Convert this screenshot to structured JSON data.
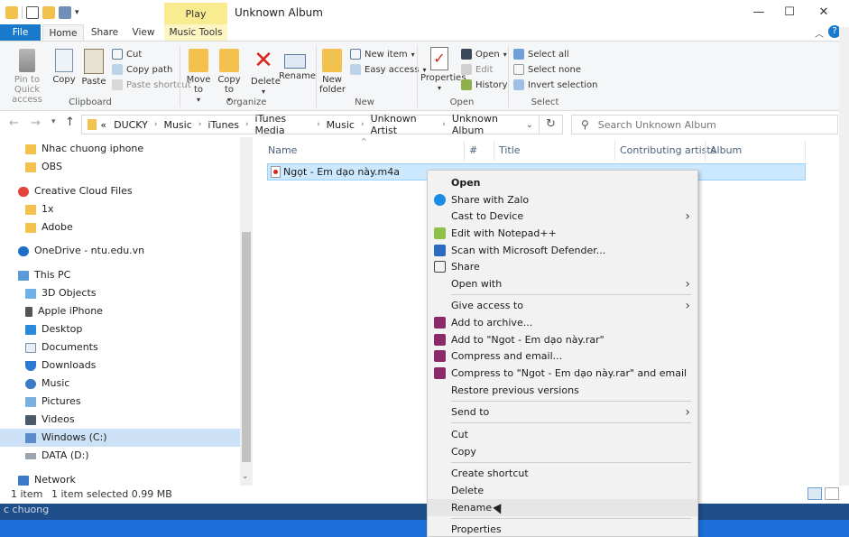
{
  "window": {
    "title": "Unknown Album",
    "play_tab": "Play",
    "controls": {
      "minimize": "—",
      "maximize": "☐",
      "close": "✕"
    }
  },
  "tabs": [
    {
      "label": "File"
    },
    {
      "label": "Home"
    },
    {
      "label": "Share"
    },
    {
      "label": "View"
    },
    {
      "label": "Music Tools"
    }
  ],
  "ribbon": {
    "clipboard": {
      "pin": "Pin to Quick access",
      "copy": "Copy",
      "paste": "Paste",
      "cut": "Cut",
      "copy_path": "Copy path",
      "paste_shortcut": "Paste shortcut",
      "label": "Clipboard"
    },
    "organize": {
      "move_to": "Move to",
      "copy_to": "Copy to",
      "delete": "Delete",
      "rename": "Rename",
      "label": "Organize"
    },
    "new": {
      "new_folder": "New folder",
      "new_item": "New item",
      "easy_access": "Easy access",
      "label": "New"
    },
    "open": {
      "properties": "Properties",
      "open": "Open",
      "edit": "Edit",
      "history": "History",
      "label": "Open"
    },
    "select": {
      "select_all": "Select all",
      "select_none": "Select none",
      "invert": "Invert selection",
      "label": "Select"
    }
  },
  "address": {
    "crumbs": [
      "«",
      "DUCKY",
      "Music",
      "iTunes",
      "iTunes Media",
      "Music",
      "Unknown Artist",
      "Unknown Album"
    ],
    "search_placeholder": "Search Unknown Album"
  },
  "nav": {
    "items": [
      {
        "label": "Nhac chuong iphone"
      },
      {
        "label": "OBS"
      },
      {
        "label": "Creative Cloud Files"
      },
      {
        "label": "1x"
      },
      {
        "label": "Adobe"
      },
      {
        "label": "OneDrive - ntu.edu.vn"
      },
      {
        "label": "This PC"
      },
      {
        "label": "3D Objects"
      },
      {
        "label": "Apple iPhone"
      },
      {
        "label": "Desktop"
      },
      {
        "label": "Documents"
      },
      {
        "label": "Downloads"
      },
      {
        "label": "Music"
      },
      {
        "label": "Pictures"
      },
      {
        "label": "Videos"
      },
      {
        "label": "Windows (C:)"
      },
      {
        "label": "DATA (D:)"
      },
      {
        "label": "Network"
      }
    ]
  },
  "columns": {
    "name": "Name",
    "number": "#",
    "title": "Title",
    "artists": "Contributing artists",
    "album": "Album"
  },
  "file": {
    "name": "Ngọt - Em dạo này.m4a"
  },
  "status": {
    "count": "1 item",
    "selected": "1 item selected  0.99 MB"
  },
  "taskbar": {
    "text": "c chuong"
  },
  "context_menu": {
    "items": [
      {
        "label": "Open"
      },
      {
        "label": "Share with Zalo"
      },
      {
        "label": "Cast to Device"
      },
      {
        "label": "Edit with Notepad++"
      },
      {
        "label": "Scan with Microsoft Defender..."
      },
      {
        "label": "Share"
      },
      {
        "label": "Open with"
      },
      {
        "label": "Give access to"
      },
      {
        "label": "Add to archive..."
      },
      {
        "label": "Add to \"Ngot - Em dạo này.rar\""
      },
      {
        "label": "Compress and email..."
      },
      {
        "label": "Compress to \"Ngot - Em dạo này.rar\" and email"
      },
      {
        "label": "Restore previous versions"
      },
      {
        "label": "Send to"
      },
      {
        "label": "Cut"
      },
      {
        "label": "Copy"
      },
      {
        "label": "Create shortcut"
      },
      {
        "label": "Delete"
      },
      {
        "label": "Rename"
      },
      {
        "label": "Properties"
      }
    ]
  },
  "colors": {
    "accent": "#1979ca",
    "selection": "#cce8ff",
    "music_tools": "#f9eb90"
  }
}
